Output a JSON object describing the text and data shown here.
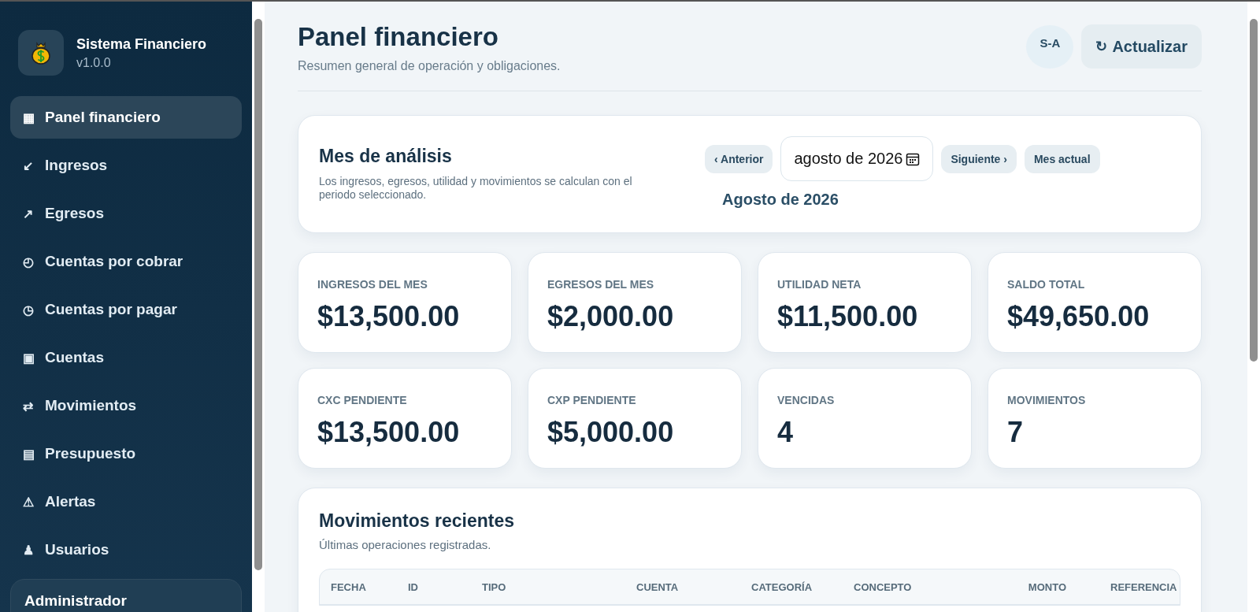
{
  "sidebar": {
    "app_name": "Sistema Financiero",
    "version": "v1.0.0",
    "items": [
      {
        "icon": "▦",
        "label": "Panel financiero",
        "selected": true
      },
      {
        "icon": "↙",
        "label": "Ingresos",
        "selected": false
      },
      {
        "icon": "↗",
        "label": "Egresos",
        "selected": false
      },
      {
        "icon": "◴",
        "label": "Cuentas por cobrar",
        "selected": false
      },
      {
        "icon": "◷",
        "label": "Cuentas por pagar",
        "selected": false
      },
      {
        "icon": "▣",
        "label": "Cuentas",
        "selected": false
      },
      {
        "icon": "⇄",
        "label": "Movimientos",
        "selected": false
      },
      {
        "icon": "▤",
        "label": "Presupuesto",
        "selected": false
      },
      {
        "icon": "⚠",
        "label": "Alertas",
        "selected": false
      },
      {
        "icon": "♟",
        "label": "Usuarios",
        "selected": false
      }
    ],
    "user_card": {
      "role": "Administrador"
    }
  },
  "header": {
    "title": "Panel financiero",
    "subtitle": "Resumen general de operación y obligaciones.",
    "avatar": "S-A",
    "refresh_icon": "↻",
    "refresh_button": "Actualizar"
  },
  "period": {
    "title": "Mes de análisis",
    "description": "Los ingresos, egresos, utilidad y movimientos se calculan con el periodo seleccionado.",
    "prev_button": "‹ Anterior",
    "month_value": "agosto de 2026",
    "next_button": "Siguiente ›",
    "current_button": "Mes actual",
    "selected_label": "Agosto de 2026"
  },
  "stats": [
    {
      "label": "INGRESOS DEL MES",
      "value": "$13,500.00"
    },
    {
      "label": "EGRESOS DEL MES",
      "value": "$2,000.00"
    },
    {
      "label": "UTILIDAD NETA",
      "value": "$11,500.00"
    },
    {
      "label": "SALDO TOTAL",
      "value": "$49,650.00"
    },
    {
      "label": "CXC PENDIENTE",
      "value": "$13,500.00"
    },
    {
      "label": "CXP PENDIENTE",
      "value": "$5,000.00"
    },
    {
      "label": "VENCIDAS",
      "value": "4"
    },
    {
      "label": "MOVIMIENTOS",
      "value": "7"
    }
  ],
  "recent": {
    "title": "Movimientos recientes",
    "subtitle": "Últimas operaciones registradas.",
    "columns": [
      "FECHA",
      "ID",
      "TIPO",
      "CUENTA",
      "CATEGORÍA",
      "CONCEPTO",
      "MONTO",
      "REFERENCIA"
    ]
  }
}
